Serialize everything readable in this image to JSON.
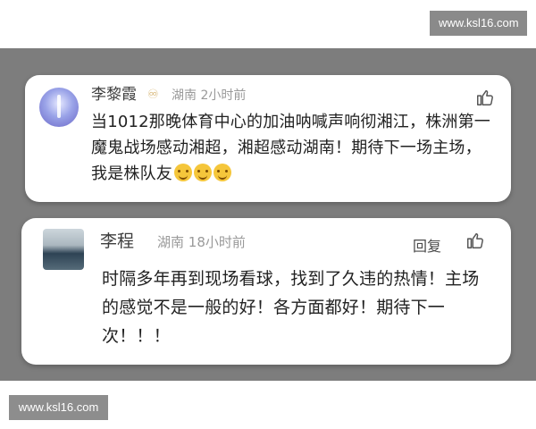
{
  "watermark": {
    "text": "www.ksl16.com"
  },
  "comments": [
    {
      "user": "李黎霞",
      "location": "湖南",
      "time": "2小时前",
      "text": "当1012那晚体育中心的加油呐喊声响彻湘江，株洲第一魔鬼战场感动湘超，湘超感动湖南！期待下一场主场，我是株队友",
      "emoji_count": 3,
      "badge_icon": "double-leaf-badge-icon",
      "like_icon": "thumbs-up-icon"
    },
    {
      "user": "李程",
      "location": "湖南",
      "time": "18小时前",
      "reply_label": "回复",
      "text": "时隔多年再到现场看球，找到了久违的热情！主场的感觉不是一般的好！各方面都好！期待下一次！！！",
      "like_icon": "thumbs-up-icon"
    }
  ]
}
